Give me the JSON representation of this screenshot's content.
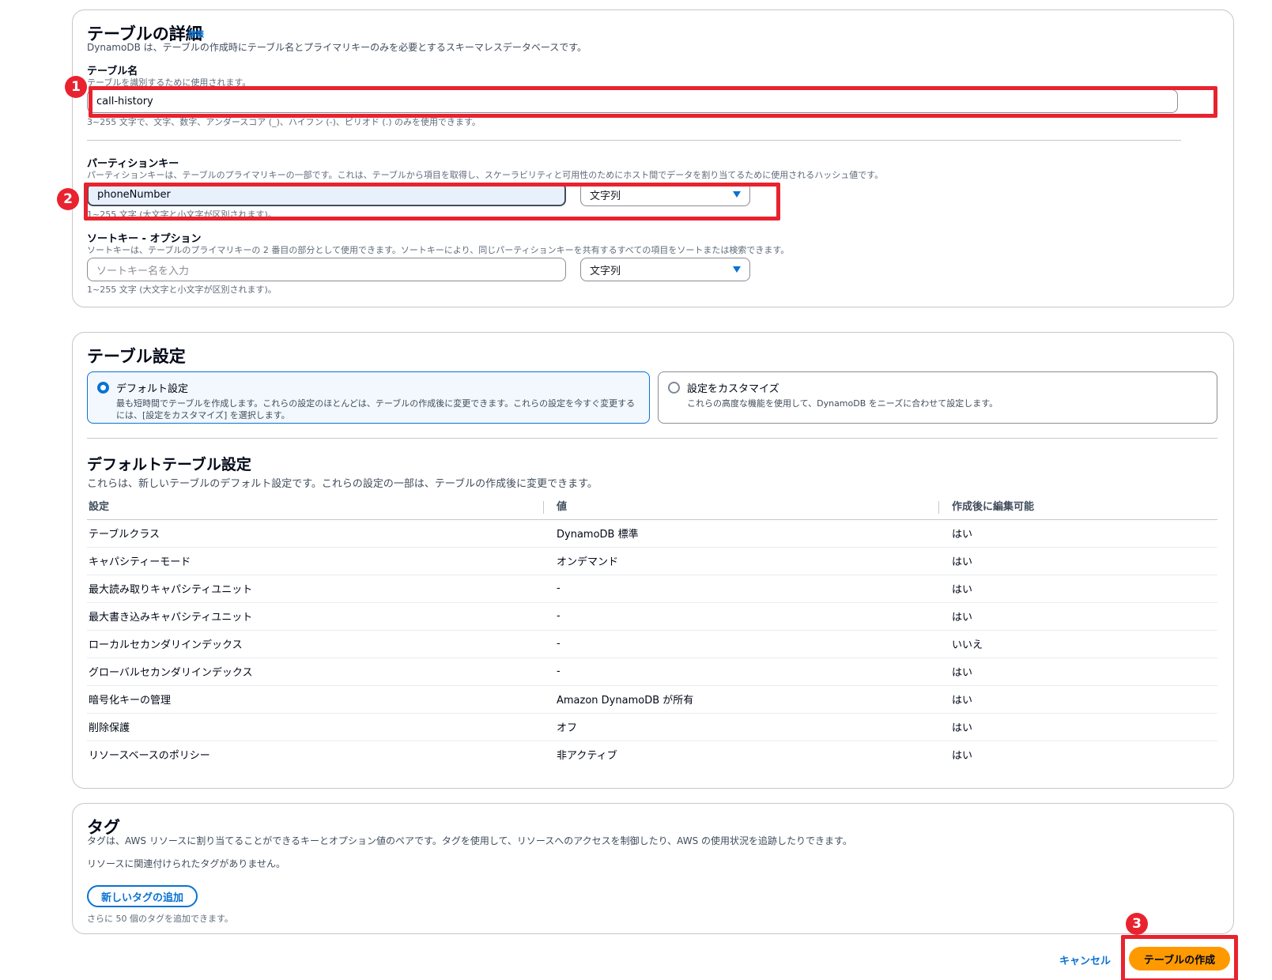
{
  "details": {
    "title": "テーブルの詳細",
    "info_link": "情報",
    "description": "DynamoDB は、テーブルの作成時にテーブル名とプライマリキーのみを必要とするスキーマレスデータベースです。",
    "table_name": {
      "label": "テーブル名",
      "hint": "テーブルを識別するために使用されます。",
      "value": "call-history",
      "constraint": "3~255 文字で、文字、数字、アンダースコア (_)、ハイフン (-)、ピリオド (.) のみを使用できます。"
    },
    "partition_key": {
      "label": "パーティションキー",
      "hint": "パーティションキーは、テーブルのプライマリキーの一部です。これは、テーブルから項目を取得し、スケーラビリティと可用性のためにホスト間でデータを割り当てるために使用されるハッシュ値です。",
      "value": "phoneNumber",
      "type": "文字列",
      "constraint": "1~255 文字 (大文字と小文字が区別されます)。"
    },
    "sort_key": {
      "label": "ソートキー - オプション",
      "hint": "ソートキーは、テーブルのプライマリキーの 2 番目の部分として使用できます。ソートキーにより、同じパーティションキーを共有するすべての項目をソートまたは検索できます。",
      "placeholder": "ソートキー名を入力",
      "type": "文字列",
      "constraint": "1~255 文字 (大文字と小文字が区別されます)。"
    }
  },
  "settings": {
    "title": "テーブル設定",
    "options": [
      {
        "title": "デフォルト設定",
        "desc": "最も短時間でテーブルを作成します。これらの設定のほとんどは、テーブルの作成後に変更できます。これらの設定を今すぐ変更するには、[設定をカスタマイズ] を選択します。",
        "selected": true
      },
      {
        "title": "設定をカスタマイズ",
        "desc": "これらの高度な機能を使用して、DynamoDB をニーズに合わせて設定します。",
        "selected": false
      }
    ],
    "defaults_title": "デフォルトテーブル設定",
    "defaults_desc": "これらは、新しいテーブルのデフォルト設定です。これらの設定の一部は、テーブルの作成後に変更できます。",
    "columns": [
      "設定",
      "値",
      "作成後に編集可能"
    ],
    "rows": [
      [
        "テーブルクラス",
        "DynamoDB 標準",
        "はい"
      ],
      [
        "キャパシティーモード",
        "オンデマンド",
        "はい"
      ],
      [
        "最大読み取りキャパシティユニット",
        "-",
        "はい"
      ],
      [
        "最大書き込みキャパシティユニット",
        "-",
        "はい"
      ],
      [
        "ローカルセカンダリインデックス",
        "-",
        "いいえ"
      ],
      [
        "グローバルセカンダリインデックス",
        "-",
        "はい"
      ],
      [
        "暗号化キーの管理",
        "Amazon DynamoDB が所有",
        "はい"
      ],
      [
        "削除保護",
        "オフ",
        "はい"
      ],
      [
        "リソースベースのポリシー",
        "非アクティブ",
        "はい"
      ]
    ]
  },
  "tags": {
    "title": "タグ",
    "description": "タグは、AWS リソースに割り当てることができるキーとオプション値のペアです。タグを使用して、リソースへのアクセスを制御したり、AWS の使用状況を追跡したりできます。",
    "empty": "リソースに関連付けられたタグがありません。",
    "add_button": "新しいタグの追加",
    "limit": "さらに 50 個のタグを追加できます。"
  },
  "footer": {
    "cancel": "キャンセル",
    "create": "テーブルの作成"
  },
  "annotations": {
    "badge1": "1",
    "badge2": "2",
    "badge3": "3",
    "color": "#e8232f"
  }
}
